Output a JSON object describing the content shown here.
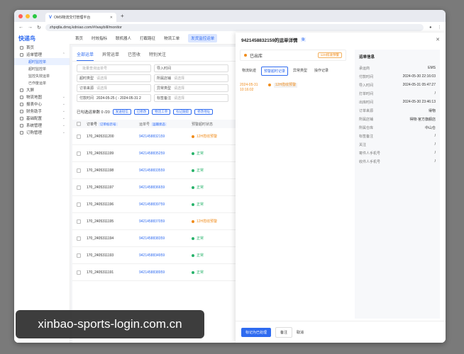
{
  "browser": {
    "tab_title": "OMS物流交付管理平台",
    "url": "zhpqtla.dmq.kdniao.com/#/waybill/monitor"
  },
  "sidebar": {
    "logo": "快递鸟",
    "menu": [
      {
        "label": "首页"
      },
      {
        "label": "运单管理"
      }
    ],
    "sub_items": [
      "超时监控单",
      "超时监控单",
      "监控失效运单",
      "已作废运单"
    ],
    "menu2": [
      "大屏",
      "物流地图",
      "报表中心",
      "财务助手",
      "基础配置",
      "系统管理",
      "订购管理"
    ]
  },
  "topnav": [
    "首页",
    "时效指标",
    "联机器人",
    "打截路征",
    "物流工单",
    "发货监控运单"
  ],
  "main": {
    "tabs": [
      "全部运单",
      "异常运单",
      "已签收",
      "特别关注"
    ],
    "filters": [
      [
        {
          "label": "",
          "val": "批量查询运单号"
        },
        {
          "label": "导入时间",
          "val": ""
        }
      ],
      [
        {
          "label": "超时类型",
          "val": "请选择"
        },
        {
          "label": "所属店铺",
          "val": "请选择"
        }
      ],
      [
        {
          "label": "订单来源",
          "val": "请选择"
        },
        {
          "label": "异常类型",
          "val": "请选择"
        }
      ],
      [
        {
          "label": "付款时间",
          "val": "2024-05-25 ( - 2024-05-31 2"
        },
        {
          "label": "标签备注",
          "val": "请选择"
        }
      ]
    ],
    "selected_text": "已勾选运单数 0 /20",
    "chips": [
      "发送短信",
      "已修改",
      "物流工单",
      "标记跟踪",
      "修改地址"
    ],
    "headers": {
      "order": "订单号",
      "order_chip": "订单标示号",
      "waybill": "运单号",
      "waybill_chip": "运输状态",
      "status": "预警超时状态"
    },
    "rows": [
      {
        "order": "170_2405311200",
        "waybill": "9421458832159",
        "status": "12H揽收预警",
        "color": "#f08c1c"
      },
      {
        "order": "170_2405311199",
        "waybill": "9421458835259",
        "status": "正常",
        "color": "#28b36b"
      },
      {
        "order": "170_2405311198",
        "waybill": "9421458833559",
        "status": "正常",
        "color": "#28b36b"
      },
      {
        "order": "170_2405311197",
        "waybill": "9421458836659",
        "status": "正常",
        "color": "#28b36b"
      },
      {
        "order": "170_2405311196",
        "waybill": "9421458839759",
        "status": "正常",
        "color": "#28b36b"
      },
      {
        "order": "170_2405311195",
        "waybill": "9421458837059",
        "status": "12H揽收预警",
        "color": "#f08c1c"
      },
      {
        "order": "170_2405311194",
        "waybill": "9421458838359",
        "status": "正常",
        "color": "#28b36b"
      },
      {
        "order": "170_2405311193",
        "waybill": "9421458834959",
        "status": "正常",
        "color": "#28b36b"
      },
      {
        "order": "170_2405311191",
        "waybill": "9421458838959",
        "status": "正常",
        "color": "#28b36b"
      }
    ]
  },
  "panel": {
    "title": "9421458832159的运单详情",
    "status": "已出库",
    "warn": "12H揽收预警",
    "tabs": [
      "物流轨迹",
      "预警超时记录",
      "异常类型",
      "操作记录"
    ],
    "timeline": {
      "date": "2024-05-31 10:16:02",
      "tag": "12H揽收预警"
    },
    "info_title": "运单信息",
    "info": [
      {
        "k": "承运商",
        "v": "EMS"
      },
      {
        "k": "付款时间",
        "v": "2024-05-30 22:16:03"
      },
      {
        "k": "导入时间",
        "v": "2024-05-31 05:47:27"
      },
      {
        "k": "打单时间",
        "v": "/"
      },
      {
        "k": "出库时间",
        "v": "2024-05-30 23:46:13"
      },
      {
        "k": "订单来源",
        "v": "得物"
      },
      {
        "k": "所属店铺",
        "v": "得物-官方旗舰店"
      },
      {
        "k": "所属仓库",
        "v": "中山仓"
      },
      {
        "k": "标签备注",
        "v": "/"
      },
      {
        "k": "关注",
        "v": "/"
      },
      {
        "k": "寄件人手机号",
        "v": "/"
      },
      {
        "k": "收件人手机号",
        "v": "/"
      }
    ],
    "footer": {
      "primary": "标记为已处理",
      "secondary": "备注",
      "cancel": "取消"
    }
  },
  "watermark": "xinbao-sports-login.com.cn"
}
